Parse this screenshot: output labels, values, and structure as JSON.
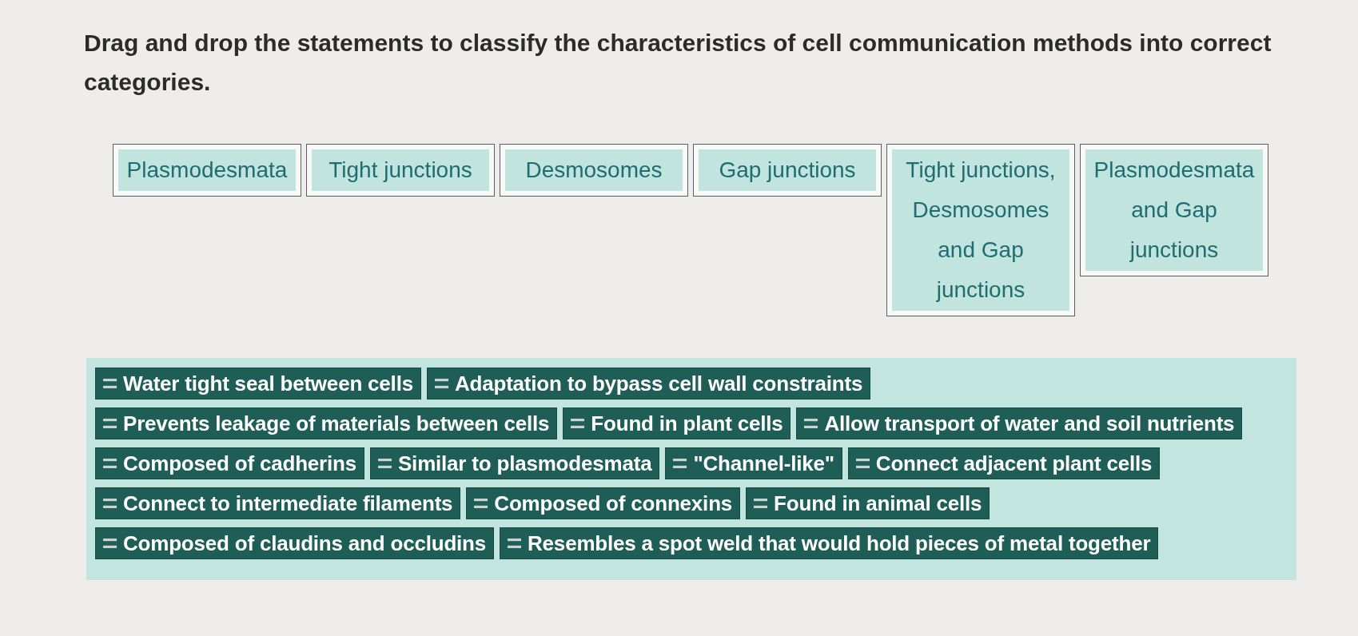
{
  "instruction": "Drag and drop the statements to classify the characteristics of cell communication methods into correct categories.",
  "categories": [
    "Plasmodesmata",
    "Tight junctions",
    "Desmosomes",
    "Gap junctions",
    "Tight junctions, Desmosomes and Gap junctions",
    "Plasmodesmata and Gap junctions"
  ],
  "statements": [
    "Water tight seal between cells",
    "Adaptation to bypass cell wall constraints",
    "Prevents leakage of materials between cells",
    "Found in plant cells",
    "Allow transport of water and soil nutrients",
    "Composed of cadherins",
    "Similar to plasmodesmata",
    "\"Channel-like\"",
    "Connect adjacent plant cells",
    "Connect to intermediate filaments",
    "Composed of connexins",
    "Found in animal cells",
    "Composed of claudins and occludins",
    "Resembles a spot weld that would hold pieces of metal together"
  ]
}
